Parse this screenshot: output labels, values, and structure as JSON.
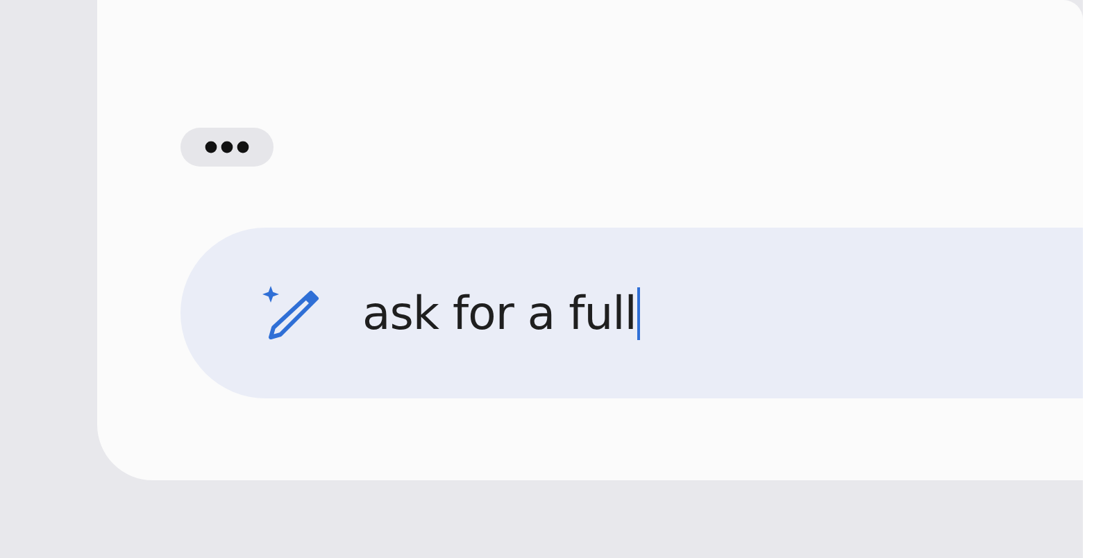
{
  "prompt": {
    "value": "ask for a full",
    "focused": true
  }
}
